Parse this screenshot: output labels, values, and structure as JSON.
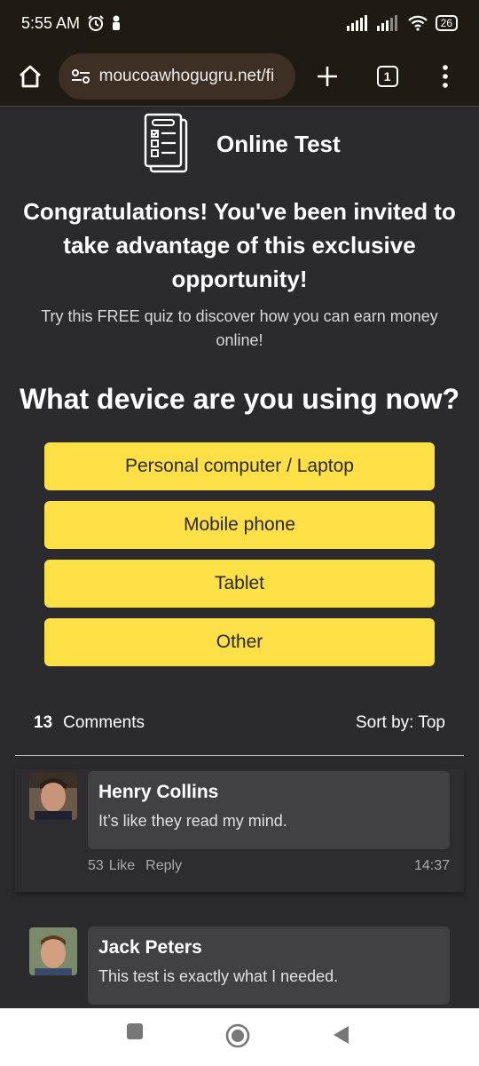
{
  "status": {
    "time": "5:55 AM",
    "battery": "26"
  },
  "browser": {
    "url": "moucoawhogugru.net/fi",
    "tab_count": "1"
  },
  "page": {
    "brand_title": "Online Test",
    "headline": "Congratulations! You've been invited to take advantage of this exclusive opportunity!",
    "subline": "Try this FREE quiz to discover how you can earn money online!",
    "question": "What device are you using now?",
    "options": [
      "Personal computer / Laptop",
      "Mobile phone",
      "Tablet",
      "Other"
    ]
  },
  "comments": {
    "count": "13",
    "label": "Comments",
    "sort": "Sort by: Top",
    "items": [
      {
        "name": "Henry Collins",
        "text": "It’s like they read my mind.",
        "likes": "53",
        "like_label": "Like",
        "reply_label": "Reply",
        "time": "14:37"
      },
      {
        "name": "Jack Peters",
        "text": "This test is exactly what I needed."
      }
    ]
  },
  "icons": {
    "home": "home-icon",
    "site_settings": "site-settings-icon",
    "new_tab": "plus-icon",
    "menu": "more-vert-icon",
    "brand": "checklist-icon"
  },
  "colors": {
    "accent": "#fddf46",
    "background": "#2b2b2d",
    "toolbar": "#1f1a14"
  }
}
